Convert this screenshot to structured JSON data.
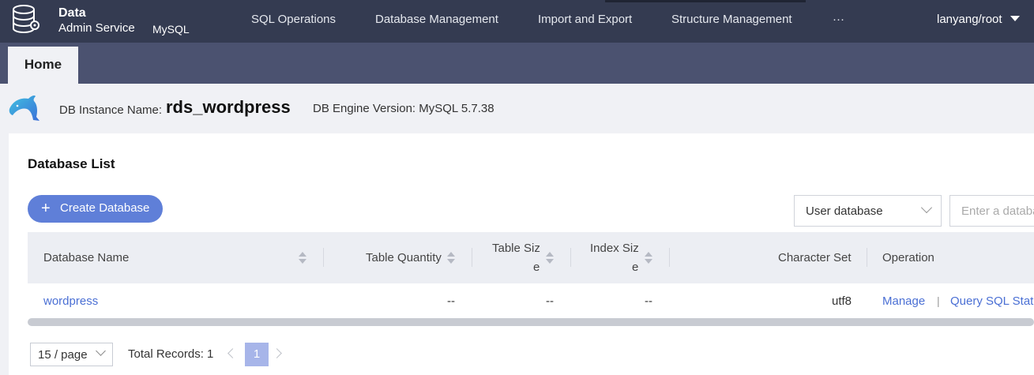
{
  "brand": {
    "line1": "Data",
    "line2": "Admin Service",
    "engine": "MySQL"
  },
  "nav": {
    "items": [
      "SQL Operations",
      "Database Management",
      "Import and Export",
      "Structure Management",
      "···"
    ],
    "user": "lanyang/root"
  },
  "tabs": {
    "home": "Home"
  },
  "instance": {
    "name_label": "DB Instance Name:",
    "name": "rds_wordpress",
    "engine_label": "DB Engine Version: MySQL 5.7.38"
  },
  "database_list": {
    "title": "Database List",
    "create_button": "Create Database",
    "filter_select": "User database",
    "search_placeholder": "Enter a database name"
  },
  "table": {
    "headers": {
      "name": "Database Name",
      "table_quantity": "Table Quantity",
      "table_size_1": "Table Siz",
      "table_size_2": "e",
      "index_size_1": "Index Siz",
      "index_size_2": "e",
      "charset": "Character Set",
      "operation": "Operation"
    },
    "rows": [
      {
        "name": "wordpress",
        "table_quantity": "--",
        "table_size": "--",
        "index_size": "--",
        "charset": "utf8",
        "manage": "Manage",
        "sep": "|",
        "query": "Query SQL Statements"
      }
    ]
  },
  "pagination": {
    "page_size": "15 / page",
    "total": "Total Records: 1",
    "current": "1"
  },
  "colors": {
    "topbar": "#343b51",
    "tabstrip": "#4b5270",
    "accent": "#5f7fd8",
    "link": "#4a6fd4"
  }
}
